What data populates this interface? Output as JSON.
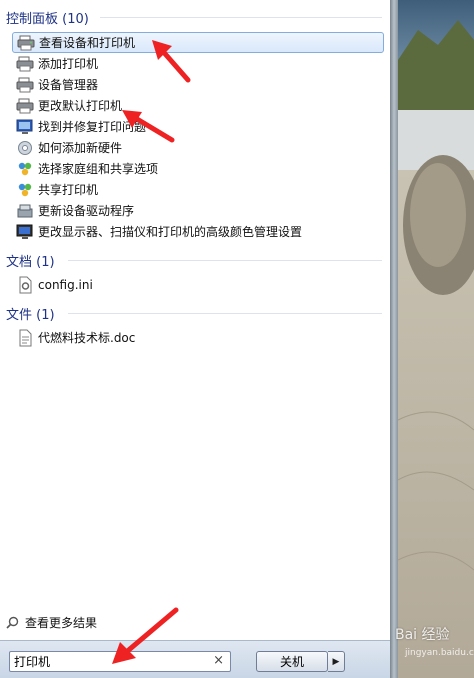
{
  "control_panel": {
    "header": "控制面板 (10)",
    "items": [
      {
        "label": "查看设备和打印机",
        "icon": "devices-printers-icon",
        "selected": true
      },
      {
        "label": "添加打印机",
        "icon": "printer-add-icon"
      },
      {
        "label": "设备管理器",
        "icon": "device-manager-icon"
      },
      {
        "label": "更改默认打印机",
        "icon": "printer-default-icon"
      },
      {
        "label": "找到并修复打印问题",
        "icon": "troubleshoot-icon"
      },
      {
        "label": "如何添加新硬件",
        "icon": "hardware-icon"
      },
      {
        "label": "选择家庭组和共享选项",
        "icon": "homegroup-icon"
      },
      {
        "label": "共享打印机",
        "icon": "share-printer-icon"
      },
      {
        "label": "更新设备驱动程序",
        "icon": "driver-update-icon"
      },
      {
        "label": "更改显示器、扫描仪和打印机的高级颜色管理设置",
        "icon": "color-management-icon"
      }
    ]
  },
  "documents": {
    "header": "文档 (1)",
    "items": [
      {
        "label": "config.ini",
        "icon": "ini-file-icon"
      }
    ]
  },
  "files": {
    "header": "文件 (1)",
    "items": [
      {
        "label": "代燃料技术标.doc",
        "icon": "doc-file-icon"
      }
    ]
  },
  "see_more": "查看更多结果",
  "search": {
    "value": "打印机"
  },
  "shutdown": {
    "label": "关机"
  },
  "watermark": {
    "text": "Bai 经验",
    "sub": "jingyan.baidu.com"
  }
}
